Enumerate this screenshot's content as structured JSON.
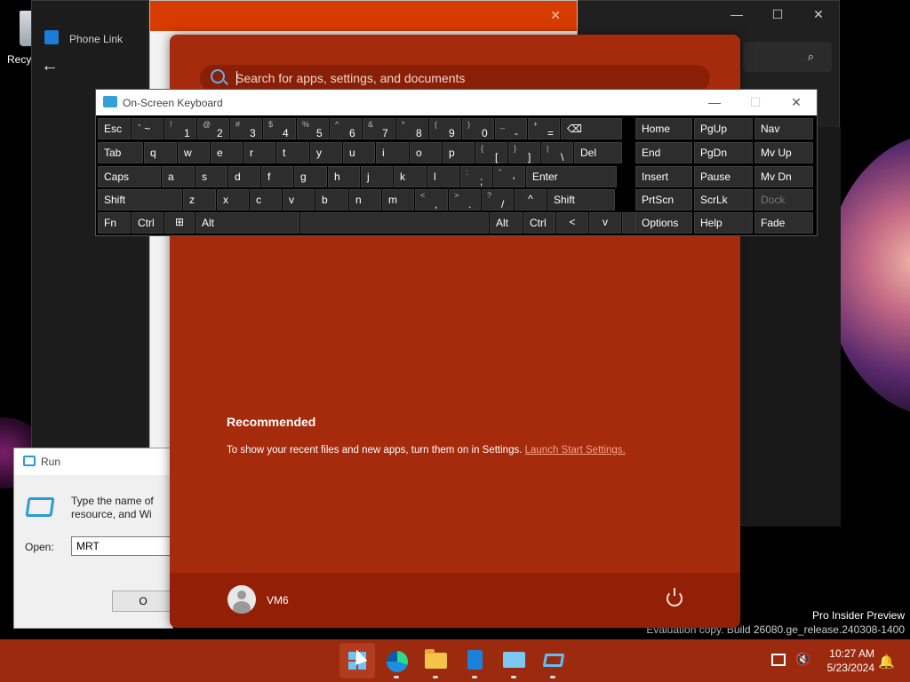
{
  "desktop": {
    "recycle_bin_label": "Recy",
    "watermark_line1": "Pro Insider Preview",
    "watermark_line2": "Evaluation copy. Build 26080.ge_release.240308-1400"
  },
  "phone_link": {
    "title": "Phone Link",
    "back_icon": "arrow-left-icon",
    "search_icon": "search-icon",
    "controls": {
      "minimize": "—",
      "maximize": "☐",
      "close": "✕"
    }
  },
  "back_window": {
    "close": "✕"
  },
  "run_dialog": {
    "title": "Run",
    "description_line1": "Type the name of",
    "description_line2": "resource, and Wi",
    "open_label": "Open:",
    "open_value": "MRT",
    "ok_label": "O"
  },
  "start_menu": {
    "search_placeholder": "Search for apps, settings, and documents",
    "recommended_title": "Recommended",
    "recommended_text": "To show your recent files and new apps, turn them on in Settings.",
    "recommended_link": "Launch Start Settings.",
    "user_name": "VM6",
    "power_icon": "power-icon"
  },
  "osk": {
    "title": "On-Screen Keyboard",
    "controls": {
      "minimize": "—",
      "maximize": "☐",
      "close": "✕"
    },
    "row1": [
      {
        "p": "Esc"
      },
      {
        "p": "` ~"
      },
      {
        "s": "!",
        "m": "1"
      },
      {
        "s": "@",
        "m": "2"
      },
      {
        "s": "#",
        "m": "3"
      },
      {
        "s": "$",
        "m": "4"
      },
      {
        "s": "%",
        "m": "5"
      },
      {
        "s": "^",
        "m": "6"
      },
      {
        "s": "&",
        "m": "7"
      },
      {
        "s": "*",
        "m": "8"
      },
      {
        "s": "(",
        "m": "9"
      },
      {
        "s": ")",
        "m": "0"
      },
      {
        "s": "_",
        "m": "-"
      },
      {
        "s": "+",
        "m": "="
      },
      {
        "p": "⌫"
      }
    ],
    "row2": [
      {
        "p": "Tab"
      },
      {
        "p": "q"
      },
      {
        "p": "w"
      },
      {
        "p": "e"
      },
      {
        "p": "r"
      },
      {
        "p": "t"
      },
      {
        "p": "y"
      },
      {
        "p": "u"
      },
      {
        "p": "i"
      },
      {
        "p": "o"
      },
      {
        "p": "p"
      },
      {
        "s": "{",
        "m": "["
      },
      {
        "s": "}",
        "m": "]"
      },
      {
        "s": "|",
        "m": "\\"
      },
      {
        "p": "Del"
      }
    ],
    "row3": [
      {
        "p": "Caps"
      },
      {
        "p": "a"
      },
      {
        "p": "s"
      },
      {
        "p": "d"
      },
      {
        "p": "f"
      },
      {
        "p": "g"
      },
      {
        "p": "h"
      },
      {
        "p": "j"
      },
      {
        "p": "k"
      },
      {
        "p": "l"
      },
      {
        "s": ":",
        "m": ";"
      },
      {
        "s": "\"",
        "m": "'"
      },
      {
        "p": "Enter"
      }
    ],
    "row4": [
      {
        "p": "Shift"
      },
      {
        "p": "z"
      },
      {
        "p": "x"
      },
      {
        "p": "c"
      },
      {
        "p": "v"
      },
      {
        "p": "b"
      },
      {
        "p": "n"
      },
      {
        "p": "m"
      },
      {
        "s": "<",
        "m": ","
      },
      {
        "s": ">",
        "m": "."
      },
      {
        "s": "?",
        "m": "/"
      },
      {
        "c": "^"
      },
      {
        "p": "Shift"
      }
    ],
    "row5": [
      {
        "p": "Fn"
      },
      {
        "p": "Ctrl"
      },
      {
        "icon": "windows-icon"
      },
      {
        "p": "Alt"
      },
      {
        "p": ""
      },
      {
        "p": "Alt"
      },
      {
        "p": "Ctrl"
      },
      {
        "c": "<"
      },
      {
        "c": "v"
      },
      {
        "c": ">"
      },
      {
        "icon": "menu-icon"
      }
    ],
    "nav": [
      [
        "Home",
        "PgUp",
        "Nav"
      ],
      [
        "End",
        "PgDn",
        "Mv Up"
      ],
      [
        "Insert",
        "Pause",
        "Mv Dn"
      ],
      [
        "PrtScn",
        "ScrLk",
        "Dock"
      ],
      [
        "Options",
        "Help",
        "Fade"
      ]
    ]
  },
  "taskbar": {
    "clock_time": "10:27 AM",
    "clock_date": "5/23/2024",
    "apps": [
      "start",
      "edge",
      "file-explorer",
      "phone-link",
      "on-screen-keyboard",
      "run"
    ]
  }
}
